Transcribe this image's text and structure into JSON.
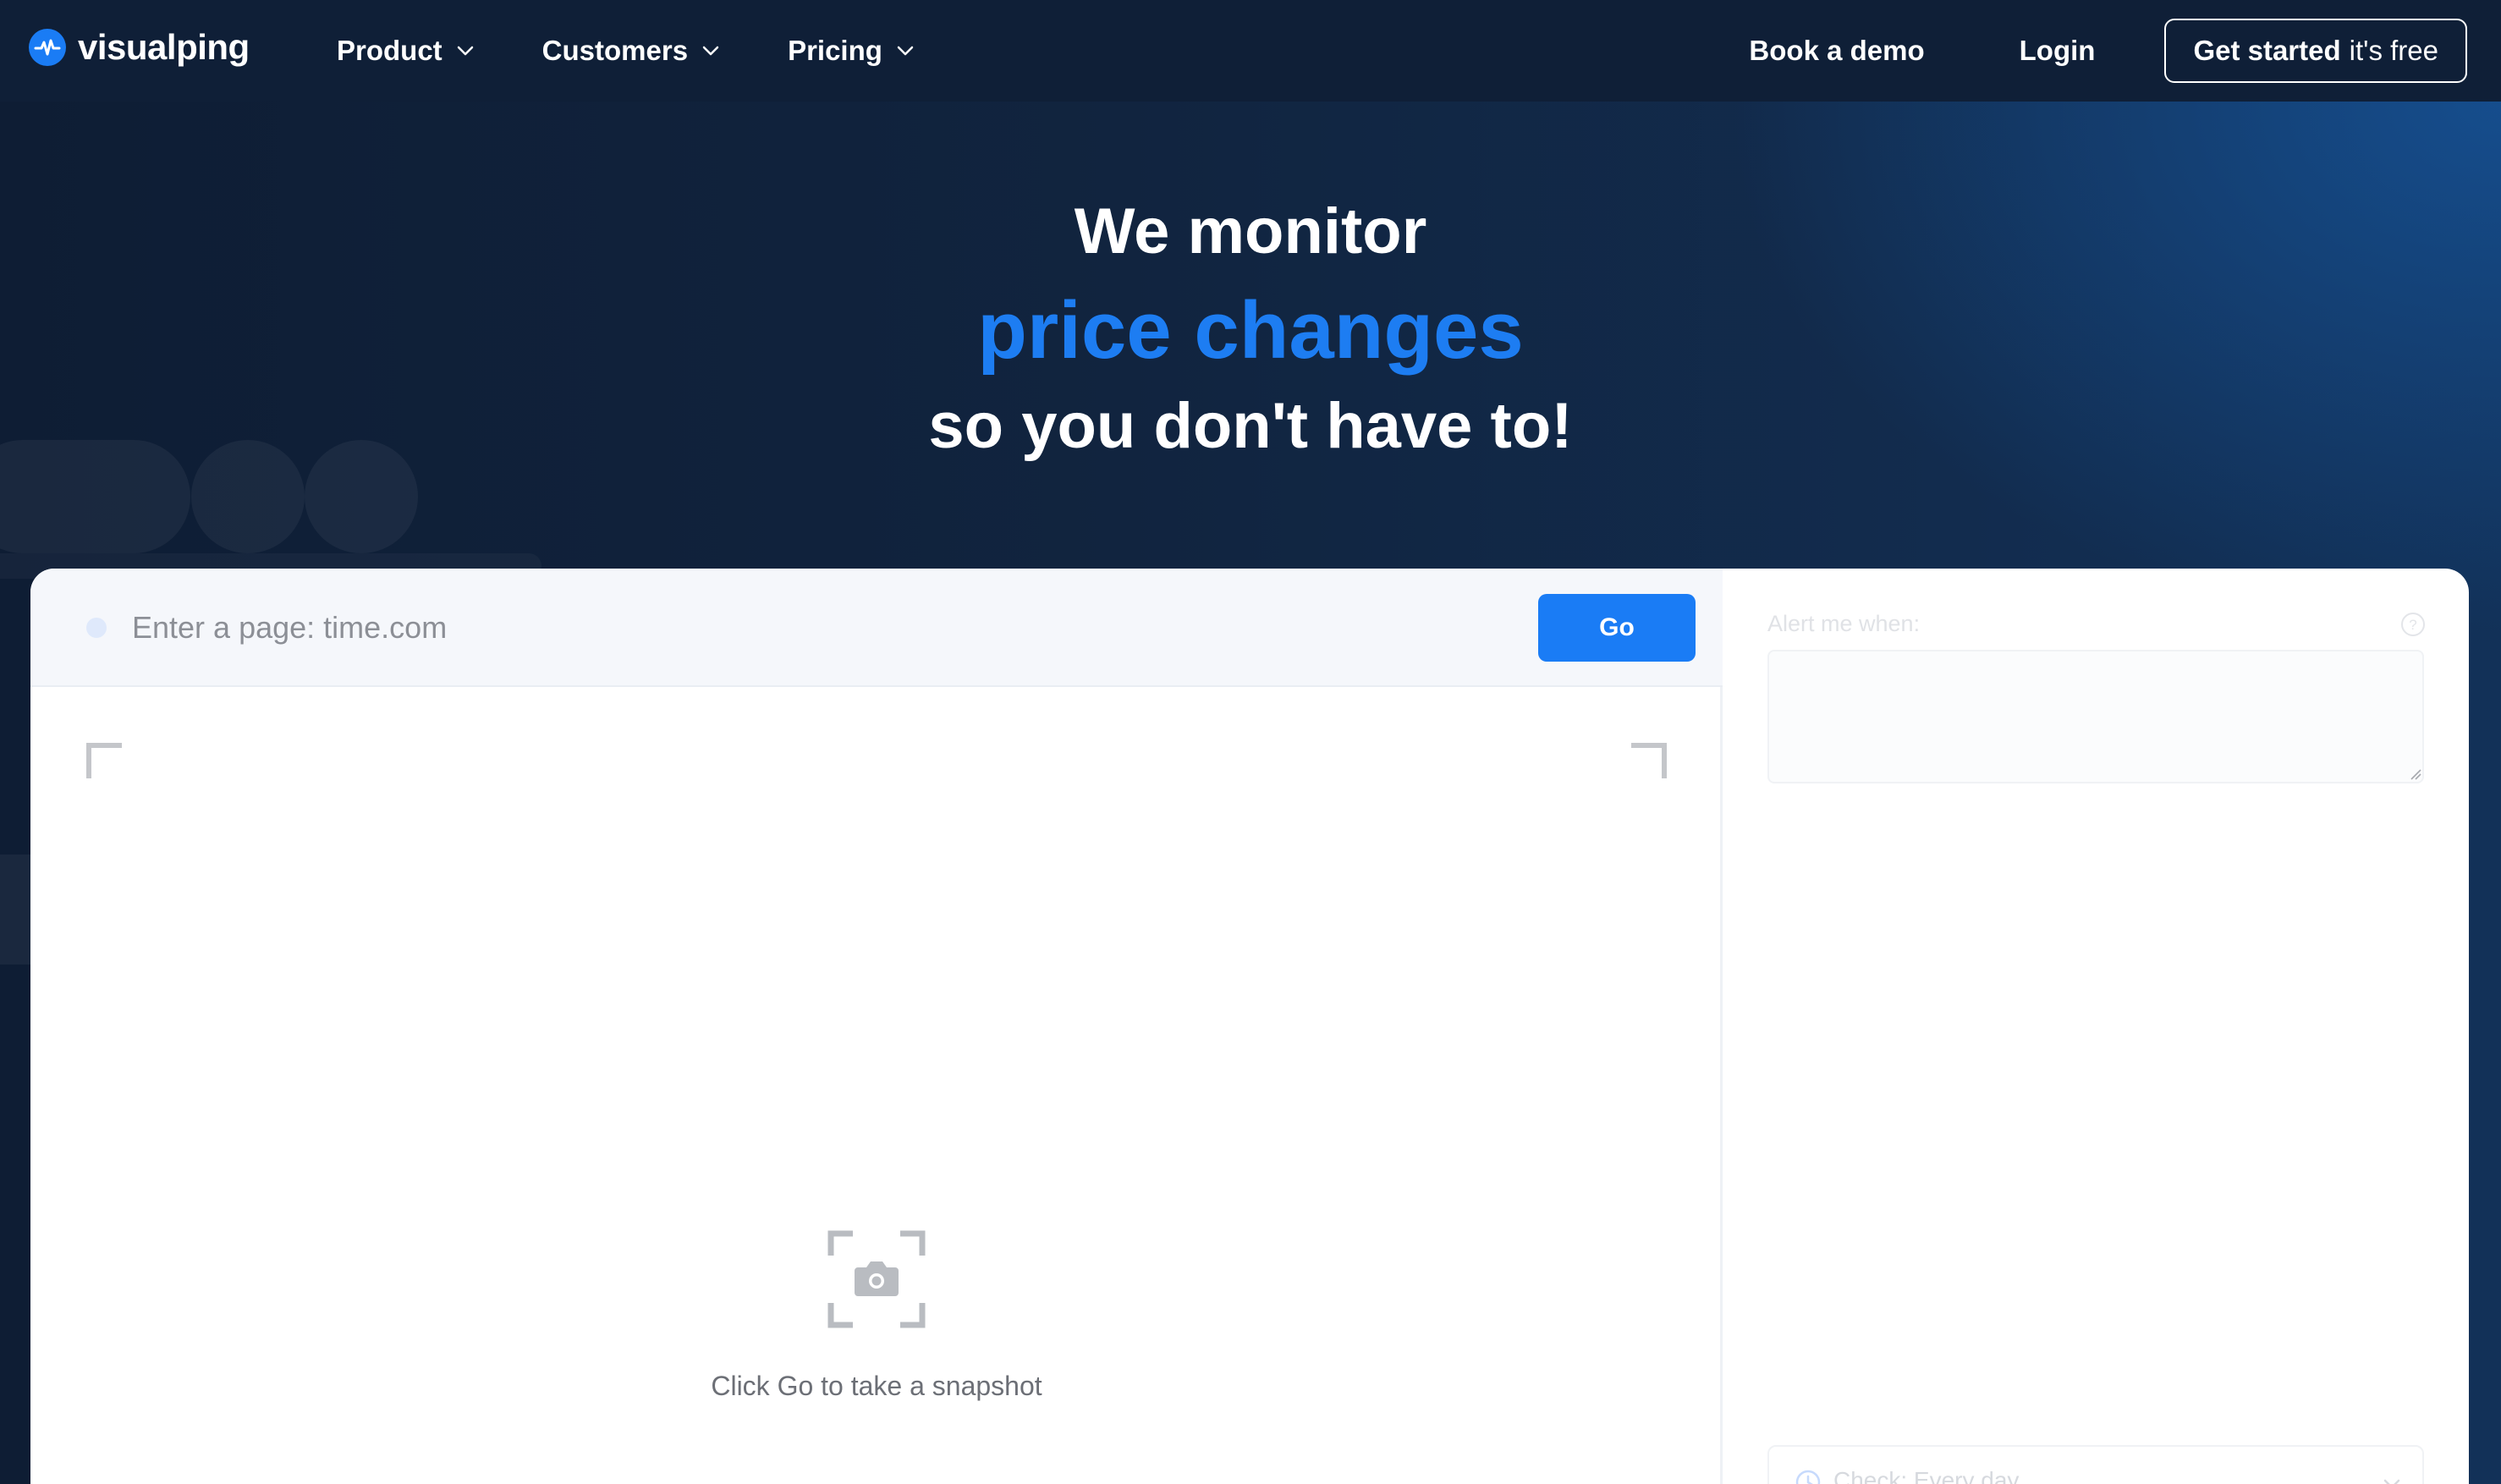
{
  "brand": {
    "name": "visualping",
    "accent": "#1a7cf5"
  },
  "nav": {
    "items": [
      {
        "label": "Product"
      },
      {
        "label": "Customers"
      },
      {
        "label": "Pricing"
      }
    ],
    "book_demo": "Book a demo",
    "login": "Login",
    "cta_strong": "Get started",
    "cta_light": "it's free"
  },
  "hero": {
    "line1": "We monitor",
    "line2": "price changes",
    "line3": "so you don't have to!"
  },
  "monitor": {
    "url_placeholder": "Enter a page: time.com",
    "url_value": "",
    "go_label": "Go",
    "snapshot_hint": "Click Go to take a snapshot",
    "alert_label": "Alert me when:",
    "alert_value": "",
    "check_label": "Check: Every day"
  },
  "icons": {
    "logo": "pulse-icon",
    "dropdown": "chevron-down-icon",
    "snapshot": "camera-icon",
    "help": "question-circle-icon",
    "clock": "clock-icon"
  }
}
